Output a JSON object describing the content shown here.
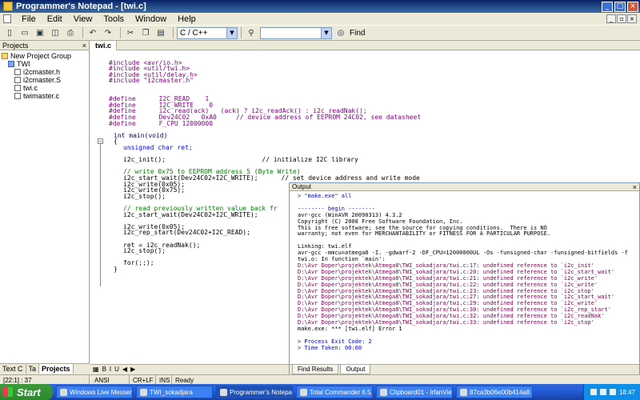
{
  "window": {
    "title": "Programmer's Notepad - [twi.c]"
  },
  "menu": [
    "File",
    "Edit",
    "View",
    "Tools",
    "Window",
    "Help"
  ],
  "toolbar": {
    "scheme": "C / C++",
    "find_value": "",
    "find_label": "Find"
  },
  "projects": {
    "title": "Projects",
    "tree": [
      {
        "label": "New Project Group",
        "indent": 0,
        "kind": "group"
      },
      {
        "label": "TWI",
        "indent": 1,
        "kind": "folder"
      },
      {
        "label": "i2cmaster.h",
        "indent": 2,
        "kind": "file"
      },
      {
        "label": "i2cmaster.S",
        "indent": 2,
        "kind": "file"
      },
      {
        "label": "twi.c",
        "indent": 2,
        "kind": "file"
      },
      {
        "label": "twimaster.c",
        "indent": 2,
        "kind": "file"
      }
    ],
    "tabs": [
      "Text C",
      "Ta",
      "Projects"
    ]
  },
  "editor": {
    "tab": "twi.c",
    "lines": [
      {
        "text": "#include <avr/io.h>",
        "color": "#7f007f",
        "row": 1
      },
      {
        "text": "#include <util/twi.h>",
        "color": "#7f007f",
        "row": 2
      },
      {
        "text": "#include <util/delay.h>",
        "color": "#7f007f",
        "row": 3
      },
      {
        "text": "#include \"i2cmaster.h\"",
        "color": "#7f007f",
        "row": 4
      },
      {
        "text": "#define      I2C_READ    1",
        "color": "#7f007f",
        "row": 7
      },
      {
        "text": "#define      I2C_WRITE    0",
        "color": "#7f007f",
        "row": 8
      },
      {
        "text": "#define      i2c_read(ack)   (ack) ? i2c_readAck() : i2c_readNak();",
        "color": "#7f007f",
        "row": 9
      },
      {
        "text": "#define      Dev24C02   0xA0     // device address of EEPROM 24C02, see datasheet",
        "color": "#7f007f",
        "row": 10
      },
      {
        "text": "#define      F_CPU 12000000",
        "color": "#7f007f",
        "row": 11
      },
      {
        "text": "int main(void)",
        "color": "#000080",
        "row": 13,
        "indent": 1
      },
      {
        "text": "{",
        "color": "#000000",
        "row": 14,
        "indent": 1
      },
      {
        "text": "unsigned char ret;",
        "color": "#0000ff",
        "row": 15,
        "indent": 3
      },
      {
        "text": "i2c_init();                         // initialize I2C library",
        "color": "#000000",
        "row": 17,
        "indent": 3
      },
      {
        "text": "// write 0x75 to EEPROM address 5 (Byte Write)",
        "color": "#008000",
        "row": 19,
        "indent": 3
      },
      {
        "text": "i2c_start_wait(Dev24C02+I2C_WRITE);      // set device address and write mode",
        "color": "#000000",
        "row": 20,
        "indent": 3
      },
      {
        "text": "i2c_write(0x05);",
        "color": "#000000",
        "row": 21,
        "indent": 3
      },
      {
        "text": "i2c_write(0x75);",
        "color": "#000000",
        "row": 22,
        "indent": 3
      },
      {
        "text": "i2c_stop();",
        "color": "#000000",
        "row": 23,
        "indent": 3
      },
      {
        "text": "// read previously written value back fr",
        "color": "#008000",
        "row": 25,
        "indent": 3
      },
      {
        "text": "i2c_start_wait(Dev24C02+I2C_WRITE);",
        "color": "#000000",
        "row": 26,
        "indent": 3
      },
      {
        "text": "i2c_write(0x05);",
        "color": "#000000",
        "row": 28,
        "indent": 3
      },
      {
        "text": "i2c_rep_start(Dev24C02+I2C_READ);",
        "color": "#000000",
        "row": 29,
        "indent": 3
      },
      {
        "text": "ret = i2c_readNak();",
        "color": "#000000",
        "row": 31,
        "indent": 3
      },
      {
        "text": "i2c_stop();",
        "color": "#000000",
        "row": 32,
        "indent": 3
      },
      {
        "text": "for(;;);",
        "color": "#000000",
        "row": 34,
        "indent": 3
      },
      {
        "text": "}",
        "color": "#000000",
        "row": 35,
        "indent": 1
      }
    ],
    "bottom_tabs": [
      "▦",
      "B",
      "I",
      "U",
      "◀",
      "▶"
    ]
  },
  "output": {
    "title": "Output",
    "lines": [
      {
        "text": "> \"make.exe\" all",
        "color": "#0000c0",
        "row": 0
      },
      {
        "text": "-------- begin --------",
        "color": "#0000c0",
        "row": 2
      },
      {
        "text": "avr-gcc (WinAVR 20090313) 4.3.2",
        "color": "#000000",
        "row": 3
      },
      {
        "text": "Copyright (C) 2008 Free Software Foundation, Inc.",
        "color": "#000000",
        "row": 4
      },
      {
        "text": "This is free software; see the source for copying conditions.  There is NO",
        "color": "#000000",
        "row": 5
      },
      {
        "text": "warranty; not even for MERCHANTABILITY or FITNESS FOR A PARTICULAR PURPOSE.",
        "color": "#000000",
        "row": 6
      },
      {
        "text": "Linking: twi.elf",
        "color": "#000000",
        "row": 8
      },
      {
        "text": "avr-gcc -mmcu=atmega8 -I. -gdwarf-2 -DF_CPU=12000000UL -Os -funsigned-char -funsigned-bitfields -f",
        "color": "#000000",
        "row": 9
      },
      {
        "text": "twi.o: In function `main':",
        "color": "#000000",
        "row": 10
      },
      {
        "text": "D:\\Avr Doper\\projektek\\Atmega8\\TWI_sokadjara/twi.c:17: undefined reference to `i2c_init'",
        "color": "#7f0055",
        "row": 11
      },
      {
        "text": "D:\\Avr Doper\\projektek\\Atmega8\\TWI_sokadjara/twi.c:20: undefined reference to `i2c_start_wait'",
        "color": "#7f0055",
        "row": 12
      },
      {
        "text": "D:\\Avr Doper\\projektek\\Atmega8\\TWI_sokadjara/twi.c:21: undefined reference to `i2c_write'",
        "color": "#7f0055",
        "row": 13
      },
      {
        "text": "D:\\Avr Doper\\projektek\\Atmega8\\TWI_sokadjara/twi.c:22: undefined reference to `i2c_write'",
        "color": "#7f0055",
        "row": 14
      },
      {
        "text": "D:\\Avr Doper\\projektek\\Atmega8\\TWI_sokadjara/twi.c:23: undefined reference to `i2c_stop'",
        "color": "#7f0055",
        "row": 15
      },
      {
        "text": "D:\\Avr Doper\\projektek\\Atmega8\\TWI_sokadjara/twi.c:27: undefined reference to `i2c_start_wait'",
        "color": "#7f0055",
        "row": 16
      },
      {
        "text": "D:\\Avr Doper\\projektek\\Atmega8\\TWI_sokadjara/twi.c:29: undefined reference to `i2c_write'",
        "color": "#7f0055",
        "row": 17
      },
      {
        "text": "D:\\Avr Doper\\projektek\\Atmega8\\TWI_sokadjara/twi.c:30: undefined reference to `i2c_rep_start'",
        "color": "#7f0055",
        "row": 18
      },
      {
        "text": "D:\\Avr Doper\\projektek\\Atmega8\\TWI_sokadjara/twi.c:32: undefined reference to `i2c_readNak'",
        "color": "#7f0055",
        "row": 19
      },
      {
        "text": "D:\\Avr Doper\\projektek\\Atmega8\\TWI_sokadjara/twi.c:33: undefined reference to `i2c_stop'",
        "color": "#7f0055",
        "row": 20
      },
      {
        "text": "make.exe: *** [twi.elf] Error 1",
        "color": "#000000",
        "row": 21
      },
      {
        "text": "> Process Exit Code: 2",
        "color": "#0000c0",
        "row": 23
      },
      {
        "text": "> Time Taken: 00:00",
        "color": "#0000c0",
        "row": 24
      }
    ],
    "tabs": [
      "Find Results",
      "Output"
    ]
  },
  "status": {
    "position": "[22:1] : 37",
    "encoding": "ANSI",
    "line_ending": "CR+LF",
    "mode": "INS",
    "state": "Ready"
  },
  "taskbar": {
    "start": "Start",
    "buttons": [
      "Windows Live Messen...",
      "TWI_sokadjara",
      "Programmer's Notepa...",
      "Total Commander 6.5...",
      "Clipboard01 - IrfanView",
      "87ca3b06e00b414a8..."
    ],
    "active_index": 2,
    "clock": "18:47"
  }
}
